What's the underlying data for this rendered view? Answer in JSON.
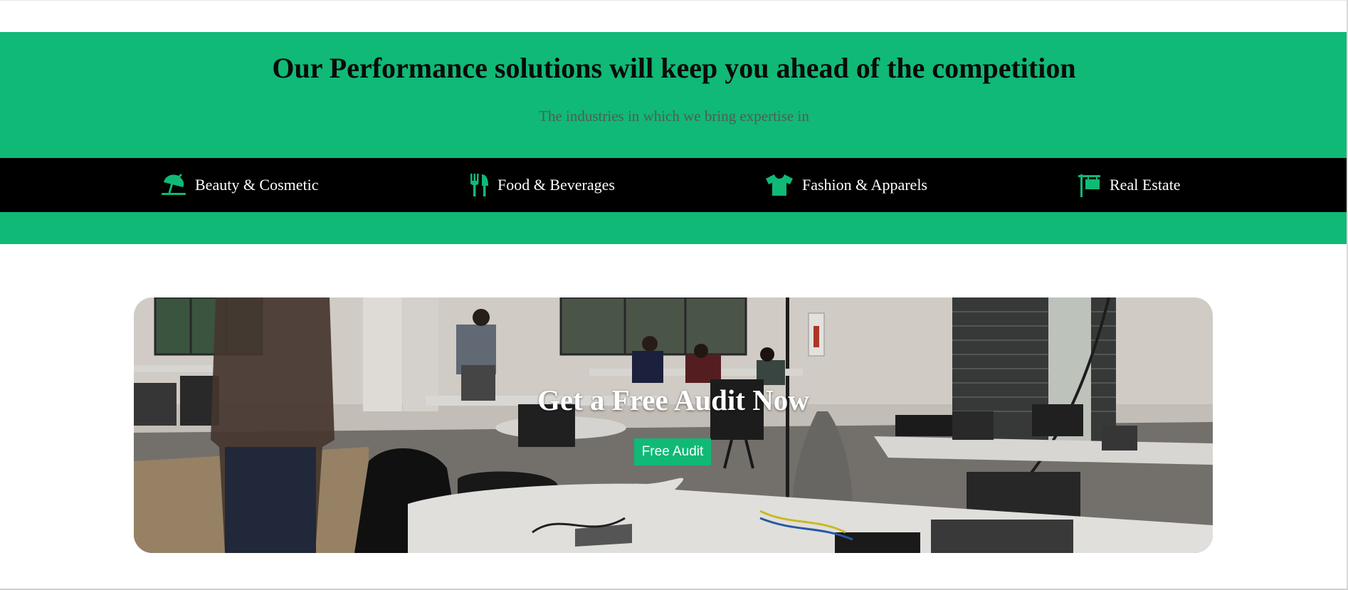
{
  "hero": {
    "title": "Our Performance solutions will keep you ahead of the competition",
    "subtitle": "The industries in which we bring expertise in"
  },
  "industries": [
    {
      "label": "Beauty & Cosmetic",
      "icon": "umbrella-beach-icon"
    },
    {
      "label": "Food & Beverages",
      "icon": "utensils-icon"
    },
    {
      "label": "Fashion & Apparels",
      "icon": "tshirt-icon"
    },
    {
      "label": "Real Estate",
      "icon": "sign-icon"
    }
  ],
  "cta": {
    "title": "Get a Free Audit Now",
    "button_label": "Free Audit"
  },
  "colors": {
    "accent": "#10b976",
    "industry_bar": "#000000",
    "headline": "#0a0a0a",
    "subtitle": "#4f5d57"
  }
}
